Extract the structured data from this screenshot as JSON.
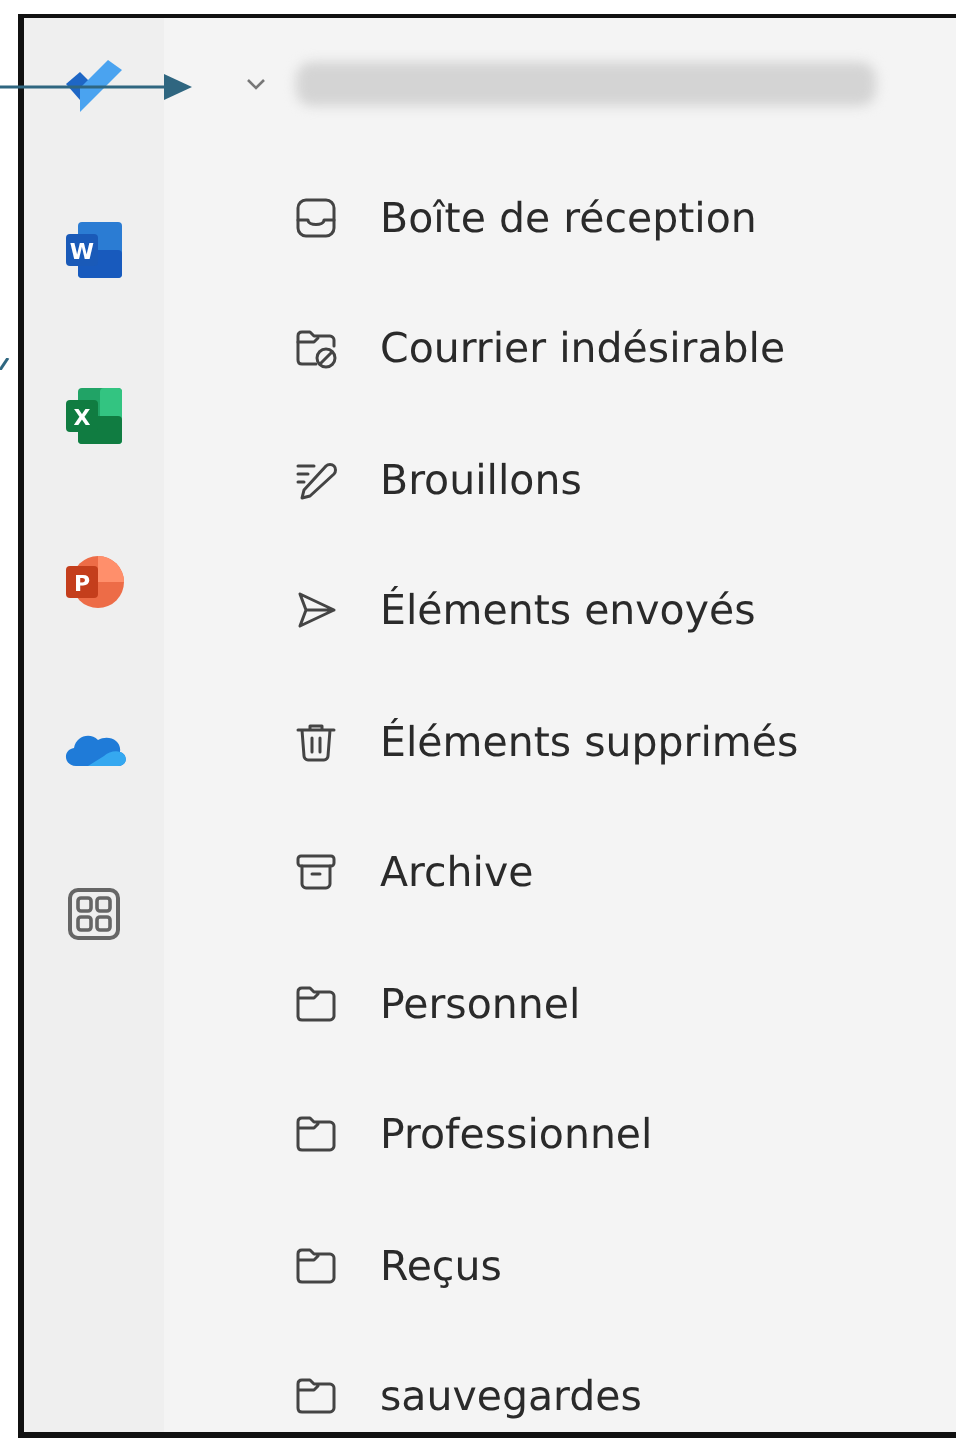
{
  "apps": [
    {
      "kind": "todo"
    },
    {
      "kind": "word",
      "letter": "W"
    },
    {
      "kind": "excel",
      "letter": "X"
    },
    {
      "kind": "powerpoint",
      "letter": "P"
    },
    {
      "kind": "onedrive"
    },
    {
      "kind": "apps"
    }
  ],
  "account": {
    "expanded": true
  },
  "folders": [
    {
      "label": "Boîte de réception",
      "kind": "inbox"
    },
    {
      "label": "Courrier indésirable",
      "kind": "junk"
    },
    {
      "label": "Brouillons",
      "kind": "drafts"
    },
    {
      "label": "Éléments envoyés",
      "kind": "sent"
    },
    {
      "label": "Éléments supprimés",
      "kind": "deleted"
    },
    {
      "label": "Archive",
      "kind": "archive"
    },
    {
      "label": "Personnel",
      "kind": "folder"
    },
    {
      "label": "Professionnel",
      "kind": "folder"
    },
    {
      "label": "Reçus",
      "kind": "folder"
    },
    {
      "label": "sauvegardes",
      "kind": "folder"
    }
  ]
}
